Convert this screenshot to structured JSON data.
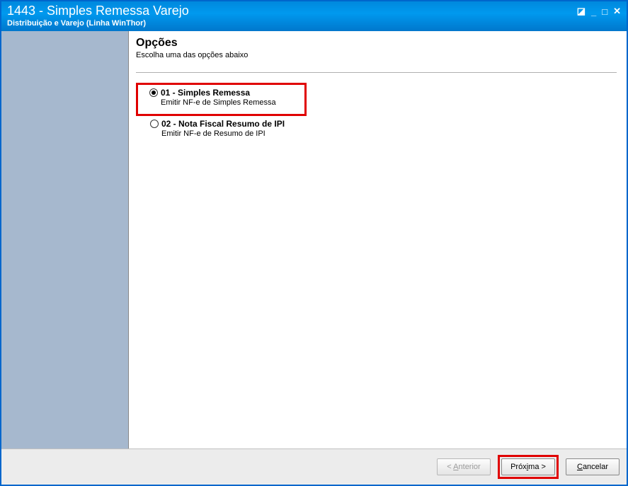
{
  "titlebar": {
    "title": "1443 - Simples Remessa Varejo",
    "subtitle": "Distribuição e Varejo (Linha WinThor)"
  },
  "page": {
    "heading": "Opções",
    "subtext": "Escolha uma das opções abaixo"
  },
  "options": [
    {
      "label": "01 - Simples Remessa",
      "desc": "Emitir NF-e de Simples Remessa",
      "checked": true,
      "highlighted": true
    },
    {
      "label": "02 - Nota Fiscal Resumo de IPI",
      "desc": "Emitir NF-e de Resumo de IPI",
      "checked": false,
      "highlighted": false
    }
  ],
  "buttons": {
    "prev_prefix": "< ",
    "prev_m": "A",
    "prev_rest": "nterior",
    "next_pre": "Próx",
    "next_m": "i",
    "next_post": "ma >",
    "cancel_m": "C",
    "cancel_rest": "ancelar"
  }
}
